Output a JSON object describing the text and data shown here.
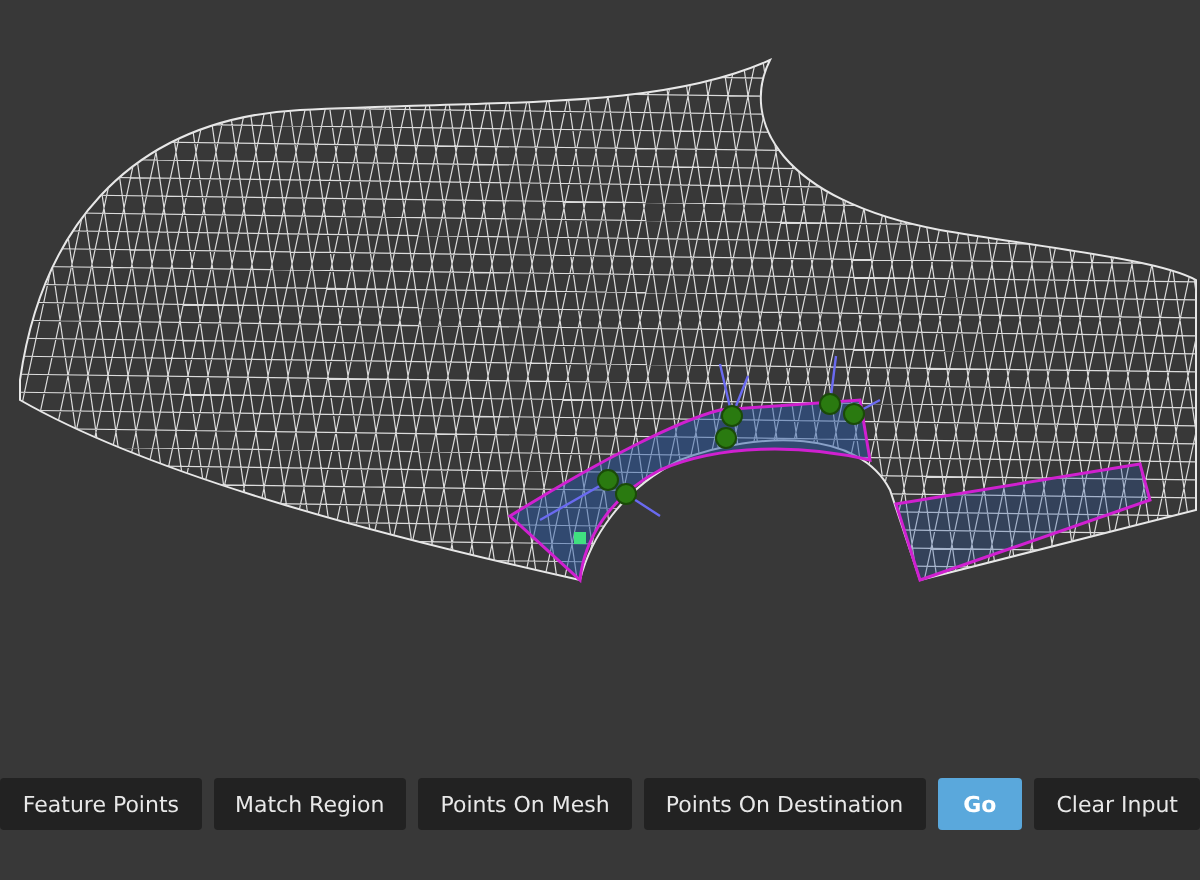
{
  "toolbar": {
    "buttons": [
      {
        "label": "Feature Points",
        "selected": false
      },
      {
        "label": "Match Region",
        "selected": false
      },
      {
        "label": "Points On Mesh",
        "selected": false
      },
      {
        "label": "Points On Destination",
        "selected": false
      },
      {
        "label": "Go",
        "selected": true
      },
      {
        "label": "Clear Input",
        "selected": false
      }
    ]
  }
}
